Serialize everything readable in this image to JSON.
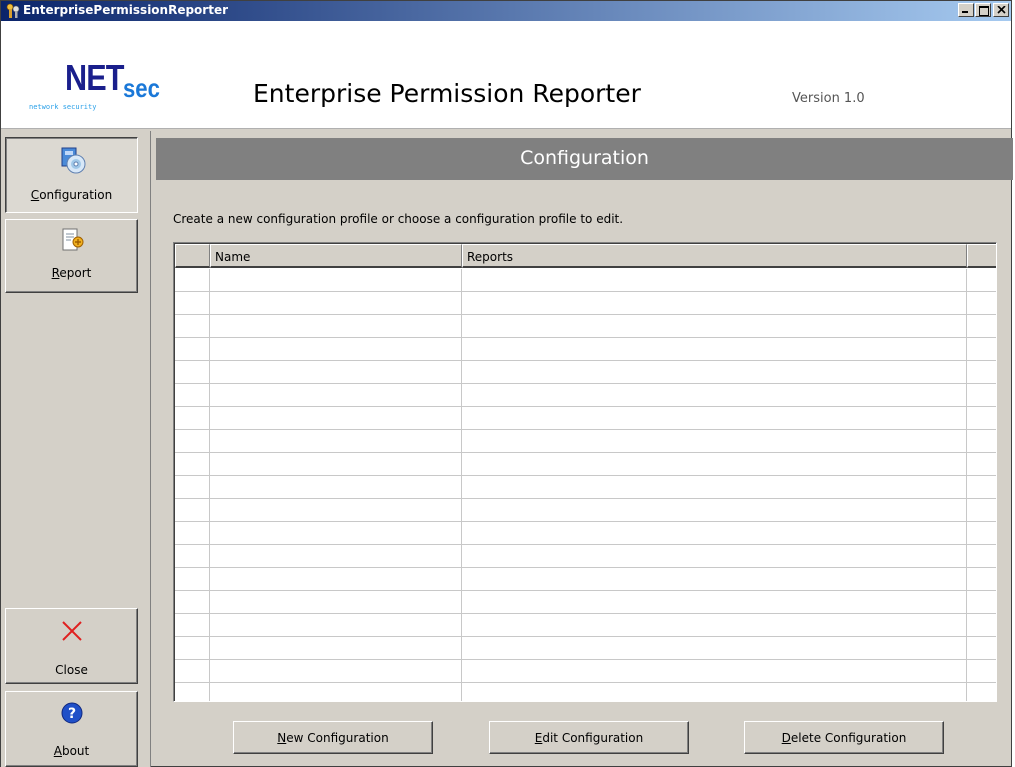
{
  "window": {
    "title": "EnterprisePermissionReporter"
  },
  "header": {
    "logo_net": "NET",
    "logo_sec": "sec",
    "logo_tagline": "network security",
    "app_title": "Enterprise Permission Reporter",
    "version": "Version 1.0"
  },
  "sidebar": {
    "items": [
      {
        "mnemonic": "C",
        "rest": "onfiguration",
        "icon": "configuration-disc-icon",
        "active": true
      },
      {
        "mnemonic": "R",
        "rest": "eport",
        "icon": "report-document-icon",
        "active": false
      },
      {
        "label": "Close",
        "icon": "close-x-icon"
      },
      {
        "mnemonic": "A",
        "rest": "bout",
        "icon": "help-question-icon"
      }
    ]
  },
  "main": {
    "panel_title": "Configuration",
    "instructions": "Create a new configuration profile or choose a configuration profile to edit.",
    "table": {
      "columns": [
        "",
        "Name",
        "Reports",
        ""
      ],
      "rows": []
    }
  },
  "buttons": {
    "new": {
      "mnemonic": "N",
      "rest": "ew Configuration"
    },
    "edit": {
      "mnemonic": "E",
      "rest": "dit Configuration"
    },
    "delete": {
      "mnemonic": "D",
      "rest": "elete Configuration"
    }
  },
  "colors": {
    "titlebar_start": "#0a246a",
    "titlebar_end": "#a6caf0",
    "panel_header": "#808080",
    "logo_blue_dark": "#1a1f8c",
    "logo_blue_light": "#1a78d8",
    "close_icon_red": "#e02020"
  }
}
